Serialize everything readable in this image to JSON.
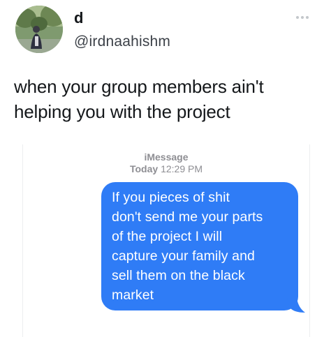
{
  "tweet": {
    "display_name": "d",
    "handle": "@irdnaahishm",
    "more_icon": "more-horizontal-icon",
    "text": "when your group members ain't helping you with the project"
  },
  "media": {
    "service_label": "iMessage",
    "time_day": "Today",
    "time_clock": "12:29 PM",
    "bubble_color": "#2f7cf6",
    "message": "If you pieces of shit\ndon't send me your parts\nof the project I will\ncapture your family and\nsell them on the black\nmarket"
  }
}
